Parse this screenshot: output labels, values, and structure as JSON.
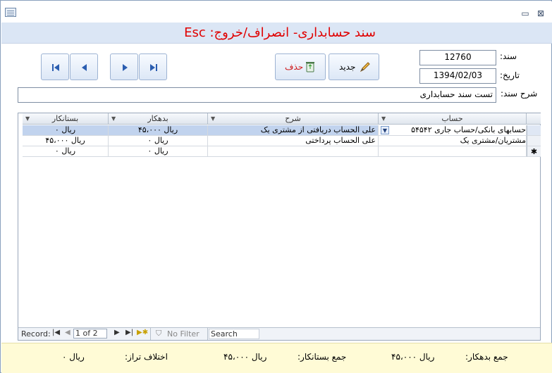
{
  "window": {
    "minimize_glyph": "▭",
    "close_glyph": "⊠"
  },
  "header": {
    "title": "سند حسابداری- انصراف/خروج: Esc"
  },
  "toolbar": {
    "first_label": "first",
    "prev_label": "prev",
    "next_label": "next",
    "last_label": "last",
    "delete_label": "حذف",
    "new_label": "جدید"
  },
  "form": {
    "doc_label": "سند:",
    "doc_value": "12760",
    "date_label": "تاریخ:",
    "date_value": "1394/02/03",
    "desc_label": "شرح سند:",
    "desc_value": "تست سند حسابداری"
  },
  "grid": {
    "columns": [
      "حساب",
      "شرح",
      "بدهکار",
      "بستانکار"
    ],
    "rows": [
      {
        "account": "حسابهای بانکی/حساب جاری ۵۴۵۴۲",
        "desc": "علی الحساب دریافتی از مشتری یک",
        "debit": "ریال ۴۵،۰۰۰",
        "credit": "ریال ۰"
      },
      {
        "account": "مشتریان/مشتری یک",
        "desc": "علی الحساب پرداختی",
        "debit": "ریال ۰",
        "credit": "ریال ۴۵،۰۰۰"
      },
      {
        "account": "",
        "desc": "",
        "debit": "ریال ۰",
        "credit": "ریال ۰"
      }
    ],
    "new_row_marker": "✱",
    "navigation": {
      "record_label": "Record:",
      "record_value": "1 of 2",
      "filter_label": "No Filter",
      "search_label": "Search"
    }
  },
  "footer": {
    "debit_total_label": "جمع بدهکار:",
    "debit_total_value": "ریال ۴۵،۰۰۰",
    "credit_total_label": "جمع بستانکار:",
    "credit_total_value": "ریال ۴۵،۰۰۰",
    "diff_label": "اختلاف تراز:",
    "diff_value": "ریال ۰"
  },
  "colors": {
    "title": "#e00000",
    "header_bg": "#dbe6f5",
    "footer_bg": "#fffbd6",
    "selection": "#c1d3ee"
  }
}
